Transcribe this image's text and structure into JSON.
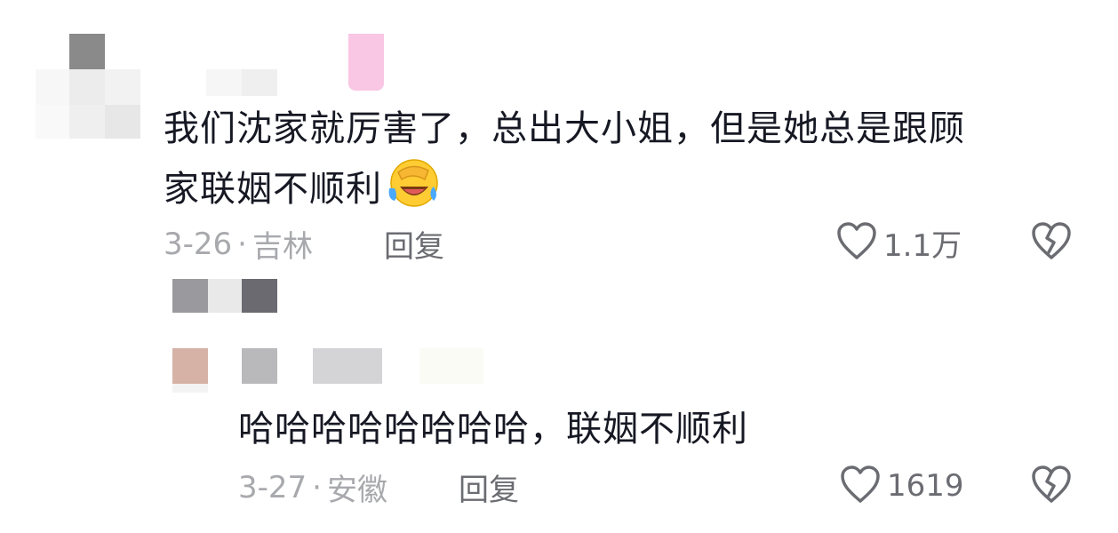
{
  "comments": [
    {
      "text_line1": "我们沈家就厉害了，总出大小姐，但是她总是跟顾",
      "text_line2": "家联姻不顺利",
      "emoji": "facepalm-laughing-emoji",
      "date": "3-26",
      "separator": "·",
      "location": "吉林",
      "reply_label": "回复",
      "likes": "1.1万",
      "icons": {
        "like": "heart-outline-icon",
        "dislike": "broken-heart-icon"
      }
    },
    {
      "text": "哈哈哈哈哈哈哈哈，联姻不顺利",
      "date": "3-27",
      "separator": "·",
      "location": "安徽",
      "reply_label": "回复",
      "likes": "1619",
      "icons": {
        "like": "heart-outline-icon",
        "dislike": "broken-heart-icon"
      }
    }
  ],
  "colors": {
    "text": "#161823",
    "meta": "#a8a9ad",
    "action": "#6b6c72",
    "censored_pink": "#f9c6e4"
  }
}
